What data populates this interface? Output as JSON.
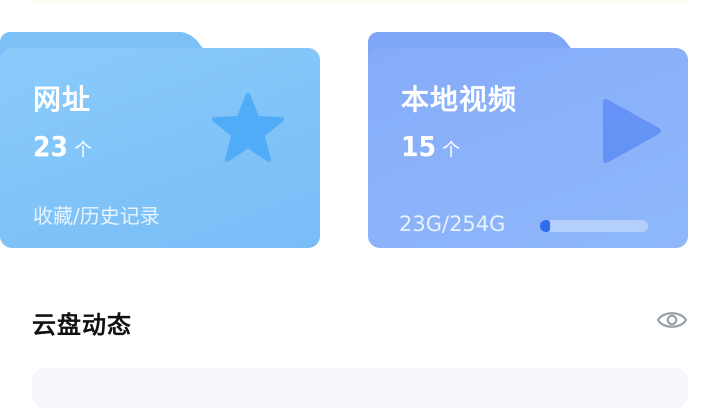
{
  "cards": {
    "url": {
      "title": "网址",
      "count": "23",
      "unit": "个",
      "description": "收藏/历史记录",
      "icon": "star-icon"
    },
    "video": {
      "title": "本地视频",
      "count": "15",
      "unit": "个",
      "storage_text": "23G/254G",
      "storage_used_fraction": 0.09,
      "icon": "play-icon"
    }
  },
  "section": {
    "title": "云盘动态",
    "visibility_icon": "eye-icon"
  },
  "colors": {
    "url_card": "#7cc0f8",
    "video_card": "#86acf9",
    "star": "#49a8f8",
    "play": "#5e8ef5",
    "storage_fill": "#2f6df0"
  }
}
